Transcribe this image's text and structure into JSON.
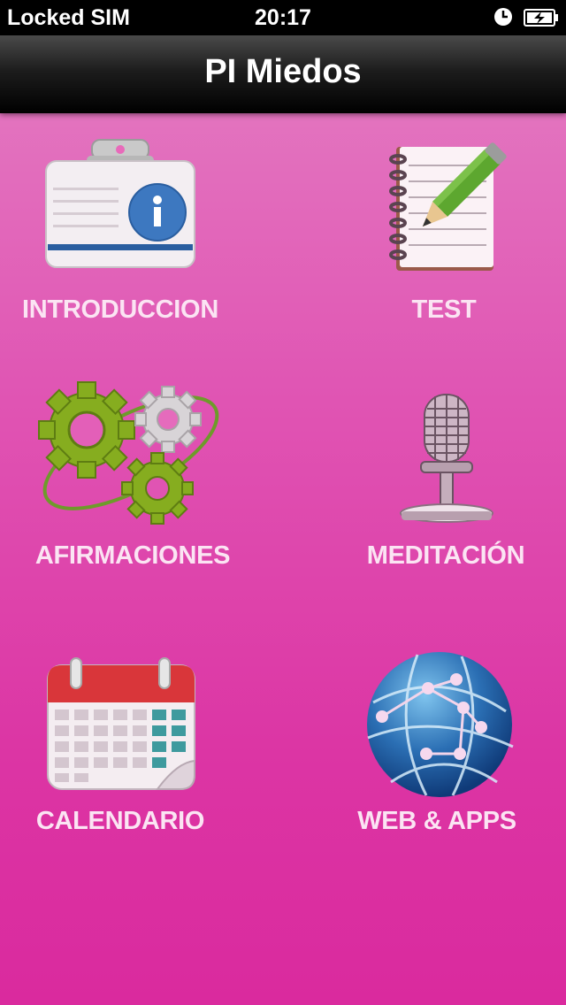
{
  "status_bar": {
    "carrier": "Locked SIM",
    "time": "20:17"
  },
  "nav": {
    "title": "PI Miedos"
  },
  "menu": [
    {
      "label": "INTRODUCCION",
      "icon": "id-badge-info-icon"
    },
    {
      "label": "TEST",
      "icon": "notepad-pencil-icon"
    },
    {
      "label": "AFIRMACIONES",
      "icon": "gears-icon"
    },
    {
      "label": "MEDITACIÓN",
      "icon": "microphone-icon"
    },
    {
      "label": "CALENDARIO",
      "icon": "calendar-icon"
    },
    {
      "label": "WEB & APPS",
      "icon": "globe-network-icon"
    }
  ],
  "colors": {
    "background_top": "#e47fc3",
    "background_bottom": "#da2a9e",
    "label": "#fbe4f3"
  }
}
